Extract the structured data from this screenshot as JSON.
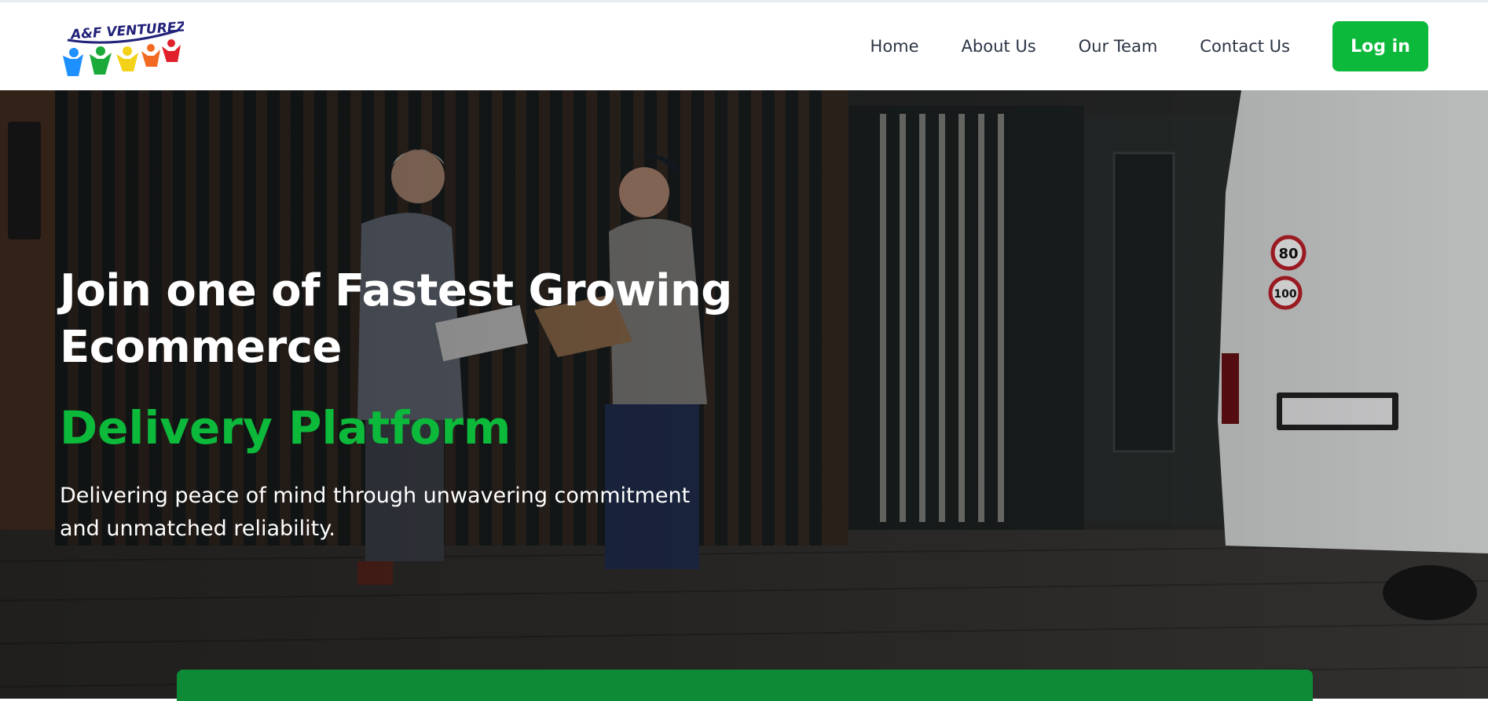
{
  "header": {
    "logo_text": "A&F VENTUREZ",
    "nav": {
      "home": "Home",
      "about": "About Us",
      "team": "Our Team",
      "contact": "Contact Us"
    },
    "login_label": "Log in"
  },
  "hero": {
    "title": "Join one of Fastest Growing Ecommerce",
    "highlight": "Delivery Platform",
    "lead": "Delivering peace of mind through unwavering commitment and unmatched reliability."
  },
  "colors": {
    "brand_green": "#0cb93b",
    "dark_green": "#0e8a36",
    "nav_text": "#2b3445"
  }
}
